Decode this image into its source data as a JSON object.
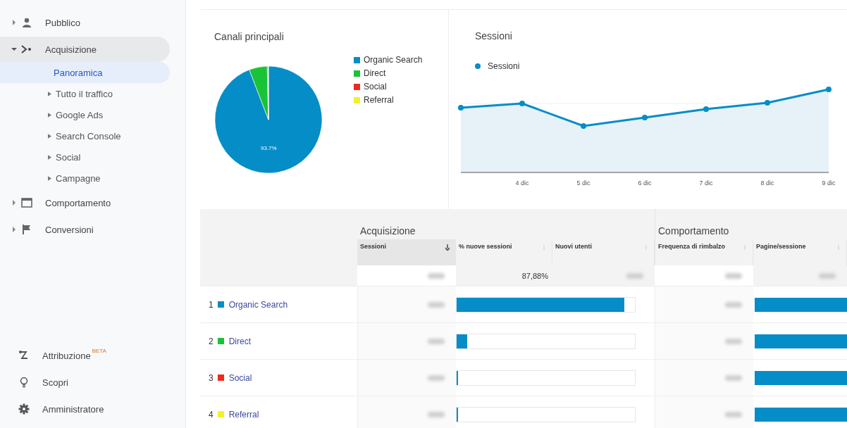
{
  "sidebar": {
    "items": [
      {
        "label": "Pubblico",
        "expanded": false
      },
      {
        "label": "Acquisizione",
        "expanded": true,
        "children": [
          {
            "label": "Panoramica",
            "selected": true,
            "expandable": false
          },
          {
            "label": "Tutto il traffico",
            "selected": false,
            "expandable": true
          },
          {
            "label": "Google Ads",
            "selected": false,
            "expandable": true
          },
          {
            "label": "Search Console",
            "selected": false,
            "expandable": true
          },
          {
            "label": "Social",
            "selected": false,
            "expandable": true
          },
          {
            "label": "Campagne",
            "selected": false,
            "expandable": true
          }
        ]
      },
      {
        "label": "Comportamento",
        "expanded": false
      },
      {
        "label": "Conversioni",
        "expanded": false
      }
    ],
    "footer": [
      {
        "label": "Attribuzione",
        "badge": "BETA"
      },
      {
        "label": "Scopri"
      },
      {
        "label": "Amministratore"
      }
    ]
  },
  "pie_card": {
    "title": "Canali principali",
    "slice_label": "93.7%",
    "legend": [
      {
        "label": "Organic Search",
        "color": "#058dc7"
      },
      {
        "label": "Direct",
        "color": "#19c337"
      },
      {
        "label": "Social",
        "color": "#ed2a1e"
      },
      {
        "label": "Referral",
        "color": "#f2f22a"
      }
    ]
  },
  "line_card": {
    "title": "Sessioni",
    "legend": "Sessioni",
    "x_labels": [
      "4 dic",
      "5 dic",
      "6 dic",
      "7 dic",
      "8 dic",
      "9 dic"
    ]
  },
  "table": {
    "groups": [
      "Acquisizione",
      "Comportamento"
    ],
    "columns": [
      {
        "label": "Sessioni",
        "sorted": true
      },
      {
        "label": "% nuove sessioni",
        "sorted": false
      },
      {
        "label": "Nuovi utenti",
        "sorted": false
      },
      {
        "label": "Frequenza di rimbalzo",
        "sorted": false
      },
      {
        "label": "Pagine/sessione",
        "sorted": false
      }
    ],
    "total_new_sessions": "87,88%",
    "rows": [
      {
        "rank": "1",
        "label": "Organic Search",
        "color": "#058dc7",
        "new_sessions_bar": {
          "level": 0.94
        },
        "pages_bar": {
          "level": 1
        }
      },
      {
        "rank": "2",
        "label": "Direct",
        "color": "#19c337",
        "new_sessions_bar": {
          "level": 0.06
        },
        "pages_bar": {
          "level": 1
        }
      },
      {
        "rank": "3",
        "label": "Social",
        "color": "#ed2a1e",
        "new_sessions_bar": {
          "level": 0.006
        },
        "pages_bar": {
          "level": 1
        }
      },
      {
        "rank": "4",
        "label": "Referral",
        "color": "#f2f22a",
        "new_sessions_bar": {
          "level": 0.006
        },
        "pages_bar": {
          "level": 1
        }
      }
    ]
  }
}
